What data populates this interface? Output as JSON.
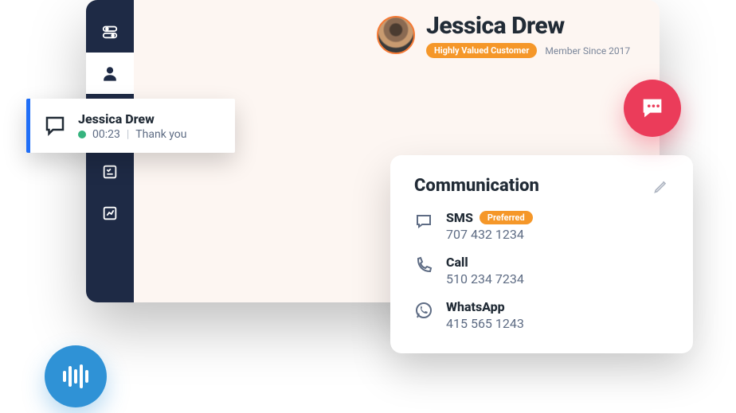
{
  "customer": {
    "name": "Jessica Drew",
    "badge": "Highly Valued Customer",
    "member_since": "Member Since 2017"
  },
  "conversation": {
    "name": "Jessica Drew",
    "status": "online",
    "timestamp": "00:23",
    "preview": "Thank you"
  },
  "communication": {
    "title": "Communication",
    "channels": [
      {
        "type": "SMS",
        "value": "707 432 1234",
        "preferred": true,
        "icon": "sms-icon"
      },
      {
        "type": "Call",
        "value": "510 234 7234",
        "preferred": false,
        "icon": "phone-icon"
      },
      {
        "type": "WhatsApp",
        "value": "415 565 1243",
        "preferred": false,
        "icon": "whatsapp-icon"
      }
    ],
    "preferred_label": "Preferred"
  },
  "sidebar": {
    "items": [
      {
        "name": "toggles",
        "active": false
      },
      {
        "name": "customer",
        "active": true
      },
      {
        "name": "id-card",
        "active": false
      },
      {
        "name": "checklist",
        "active": false
      },
      {
        "name": "analytics",
        "active": false
      }
    ]
  }
}
